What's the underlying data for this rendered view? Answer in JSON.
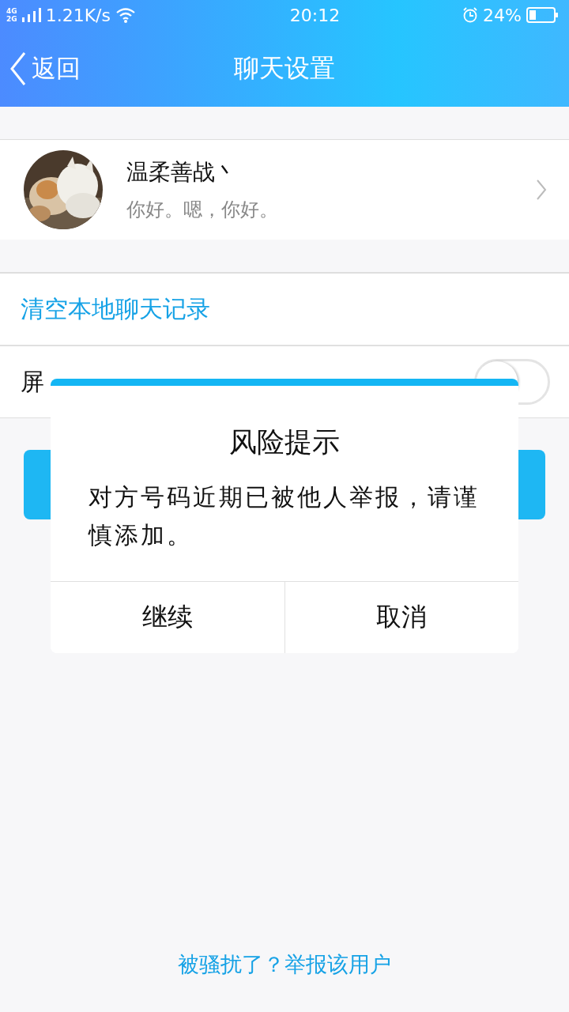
{
  "status_bar": {
    "network": "4G 2G",
    "speed": "1.21K/s",
    "time": "20:12",
    "battery": "24%"
  },
  "nav": {
    "back": "返回",
    "title": "聊天设置"
  },
  "profile": {
    "name": "温柔善战丶",
    "signature": "你好。嗯，你好。"
  },
  "actions": {
    "clear": "清空本地聊天记录",
    "block": {
      "label": "屏",
      "on": false
    }
  },
  "dialog": {
    "title": "风险提示",
    "message": "对方号码近期已被他人举报，请谨慎添加。",
    "buttons": [
      "继续",
      "取消"
    ]
  },
  "footer": {
    "report": "被骚扰了？举报该用户"
  }
}
